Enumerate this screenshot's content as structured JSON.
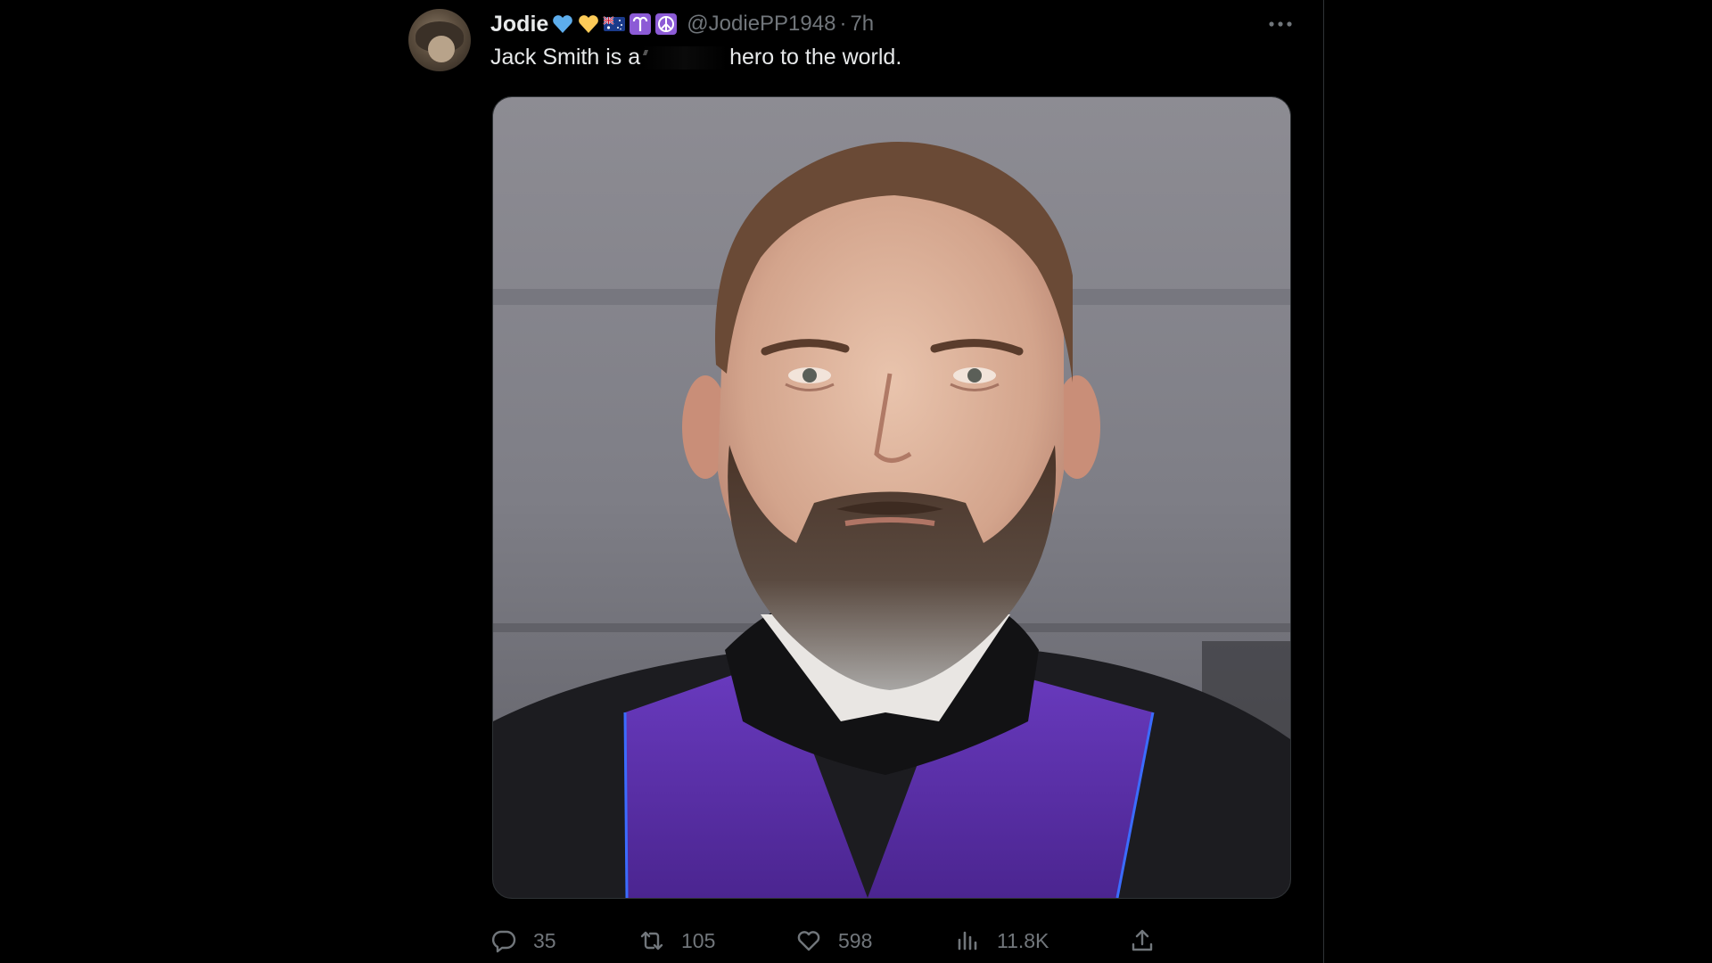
{
  "tweet": {
    "author_name": "Jodie",
    "author_emojis": [
      "blue-heart-icon",
      "yellow-heart-icon",
      "australia-flag-icon",
      "aries-icon",
      "peace-sign-icon"
    ],
    "handle": "@JodiePP1948",
    "separator": "·",
    "time": "7h",
    "text_before": "Jack Smith is a",
    "text_after": "hero to the world.",
    "colors": {
      "background": "#000000",
      "text": "#e7e9ea",
      "muted": "#71767b",
      "border": "#2f3336",
      "robe_purple": "#5a2fa8"
    }
  },
  "actions": {
    "replies": "35",
    "reposts": "105",
    "likes": "598",
    "views": "11.8K"
  }
}
